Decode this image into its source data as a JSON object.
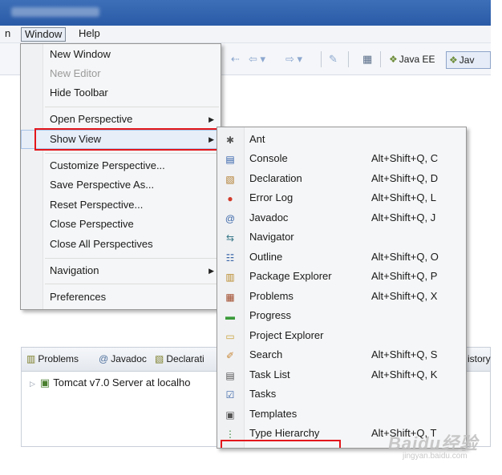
{
  "menubar": {
    "window": "Window",
    "help": "Help"
  },
  "toolbar": {
    "perspectives": [
      {
        "label": "Java EE",
        "icon": "java-ee-perspective-icon"
      },
      {
        "label": "Jav",
        "icon": "java-perspective-icon"
      }
    ]
  },
  "window_menu": {
    "items": [
      {
        "label": "New Window"
      },
      {
        "label": "New Editor",
        "disabled": true
      },
      {
        "label": "Hide Toolbar"
      },
      {
        "label": "Open Perspective",
        "submenu": true
      },
      {
        "label": "Show View",
        "submenu": true,
        "highlighted": true
      },
      {
        "label": "Customize Perspective..."
      },
      {
        "label": "Save Perspective As..."
      },
      {
        "label": "Reset Perspective..."
      },
      {
        "label": "Close Perspective"
      },
      {
        "label": "Close All Perspectives"
      },
      {
        "label": "Navigation",
        "submenu": true
      },
      {
        "label": "Preferences"
      }
    ]
  },
  "show_view_menu": {
    "items": [
      {
        "label": "Ant",
        "accel": "",
        "icon": "ant-icon"
      },
      {
        "label": "Console",
        "accel": "Alt+Shift+Q, C",
        "icon": "console-icon"
      },
      {
        "label": "Declaration",
        "accel": "Alt+Shift+Q, D",
        "icon": "declaration-icon"
      },
      {
        "label": "Error Log",
        "accel": "Alt+Shift+Q, L",
        "icon": "error-log-icon"
      },
      {
        "label": "Javadoc",
        "accel": "Alt+Shift+Q, J",
        "icon": "javadoc-icon"
      },
      {
        "label": "Navigator",
        "accel": "",
        "icon": "navigator-icon"
      },
      {
        "label": "Outline",
        "accel": "Alt+Shift+Q, O",
        "icon": "outline-icon"
      },
      {
        "label": "Package Explorer",
        "accel": "Alt+Shift+Q, P",
        "icon": "package-explorer-icon"
      },
      {
        "label": "Problems",
        "accel": "Alt+Shift+Q, X",
        "icon": "problems-icon"
      },
      {
        "label": "Progress",
        "accel": "",
        "icon": "progress-icon"
      },
      {
        "label": "Project Explorer",
        "accel": "",
        "icon": "project-explorer-icon"
      },
      {
        "label": "Search",
        "accel": "Alt+Shift+Q, S",
        "icon": "search-icon"
      },
      {
        "label": "Task List",
        "accel": "Alt+Shift+Q, K",
        "icon": "task-list-icon"
      },
      {
        "label": "Tasks",
        "accel": "",
        "icon": "tasks-icon"
      },
      {
        "label": "Templates",
        "accel": "",
        "icon": "templates-icon"
      },
      {
        "label": "Type Hierarchy",
        "accel": "Alt+Shift+Q, T",
        "icon": "type-hierarchy-icon"
      }
    ]
  },
  "bottom_panel": {
    "tabs": [
      "Problems",
      "Javadoc",
      "Declarati"
    ],
    "tab_overflow": "istory",
    "server_row": "Tomcat v7.0 Server at localho"
  },
  "watermark": {
    "brand": "Baidu经验",
    "url": "jingyan.baidu.com"
  },
  "colors": {
    "highlight_box": "#e3161b",
    "title_bar": "#2a5aa6"
  }
}
